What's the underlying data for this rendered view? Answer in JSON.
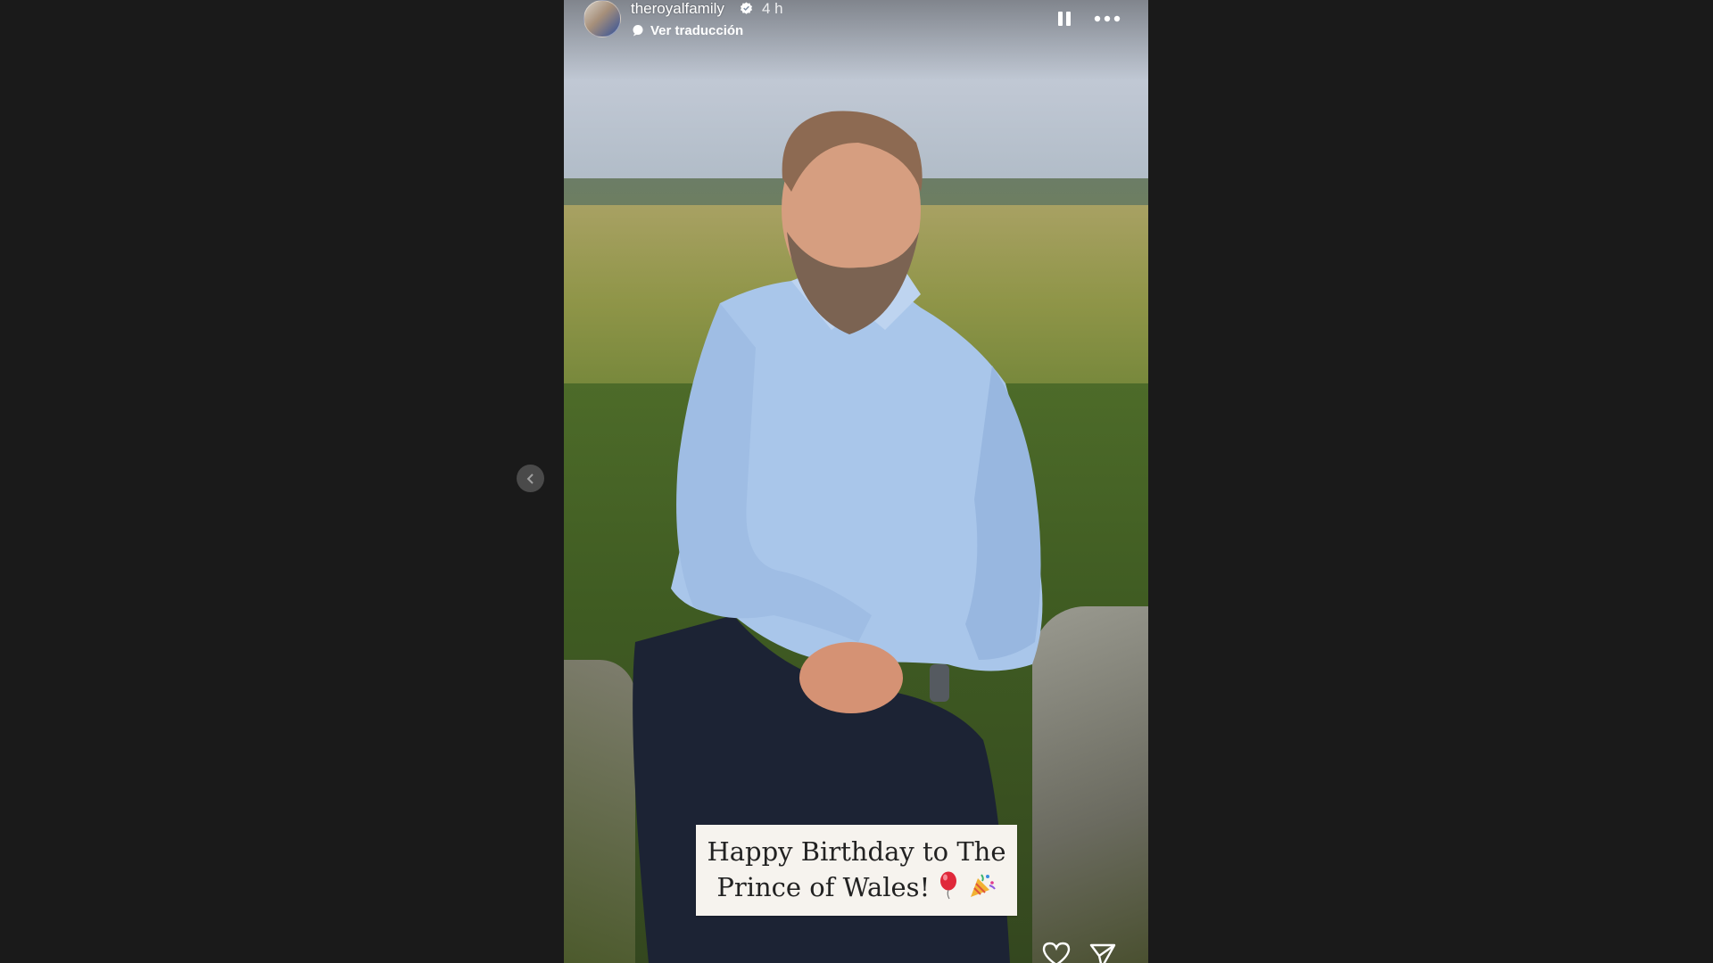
{
  "story": {
    "username": "theroyalfamily",
    "time_ago": "4 h",
    "translate_label": "Ver traducción",
    "caption_line1": "Happy Birthday to The",
    "caption_line2": "Prince of Wales!",
    "caption_emojis": [
      "balloon",
      "party-popper"
    ]
  },
  "colors": {
    "page_background": "#1a1a1a",
    "caption_background": "#f6f3ee"
  },
  "icons": {
    "verified": "verified-badge-icon",
    "translate": "translate-icon",
    "pause": "pause-icon",
    "more": "more-options-icon",
    "like": "heart-icon",
    "share": "send-icon",
    "previous": "chevron-left-icon"
  }
}
